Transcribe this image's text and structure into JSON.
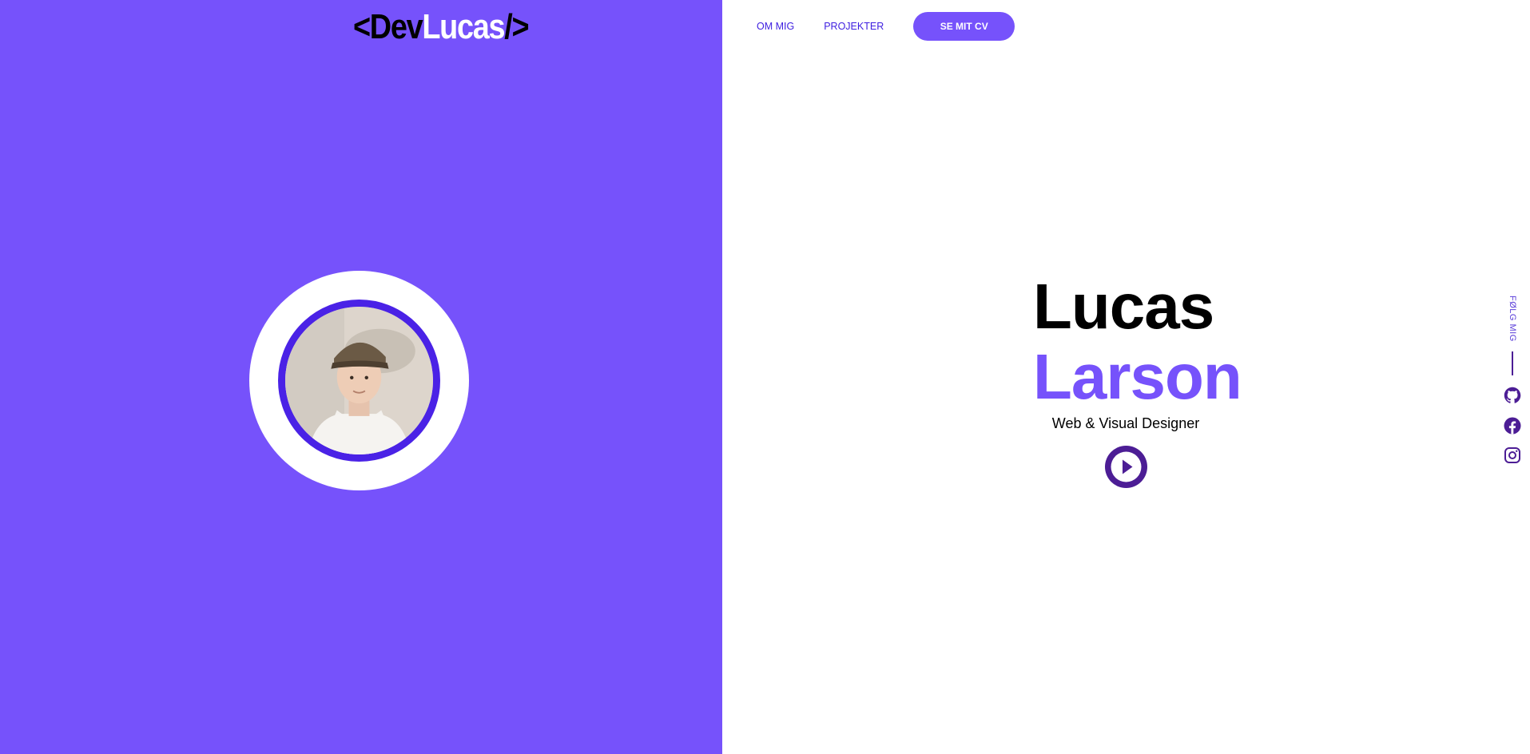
{
  "logo": {
    "part1": "<Dev",
    "part2": "Lucas",
    "part3": "/>"
  },
  "nav": {
    "items": [
      {
        "label": "OM MIG"
      },
      {
        "label": "PROJEKTER"
      }
    ],
    "cv_button": "SE MIT CV"
  },
  "hero": {
    "first_name": "Lucas",
    "last_name": "Larson",
    "subtitle": "Web & Visual Designer",
    "play_icon": "play-icon"
  },
  "social": {
    "label": "FØLG MIG",
    "icons": [
      "github-icon",
      "facebook-icon",
      "instagram-icon"
    ]
  },
  "colors": {
    "accent": "#7652fb",
    "accent_dark": "#4c1d95",
    "ring": "#4a22e6",
    "nav_link": "#3d1ee0"
  }
}
